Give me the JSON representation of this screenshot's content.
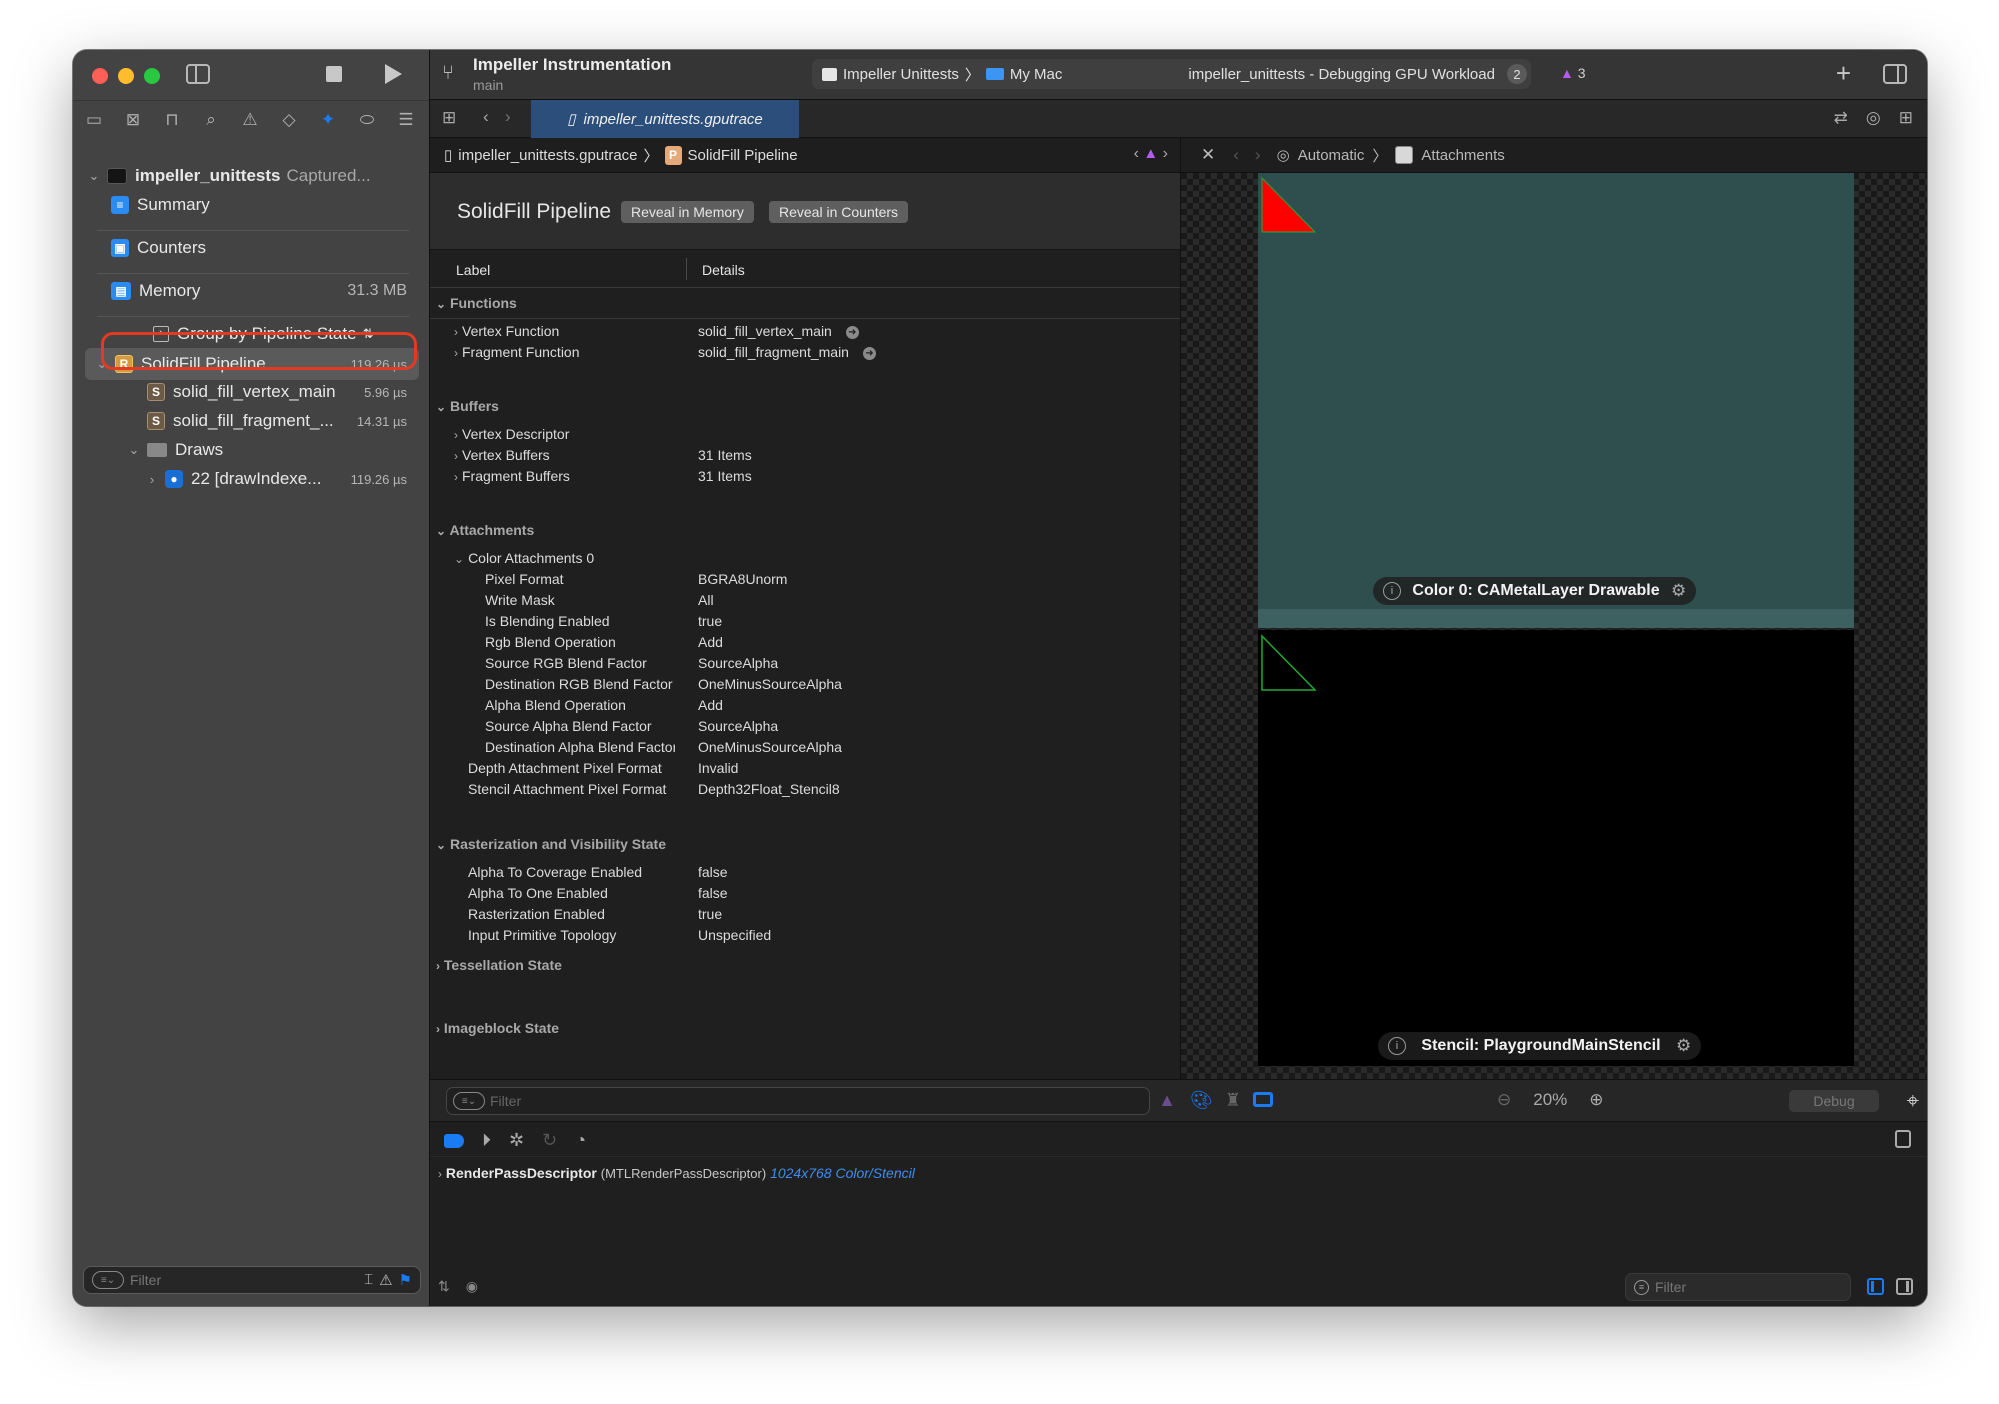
{
  "window": {
    "project_title": "Impeller Instrumentation",
    "branch": "main",
    "scheme": {
      "target": "Impeller Unittests",
      "destination": "My Mac"
    },
    "status": {
      "text": "impeller_unittests - Debugging GPU Workload",
      "badge": "2",
      "warnings": "3"
    }
  },
  "icons": {
    "sep": "〉",
    "chevron_right": "›",
    "chevron_down": "⌄",
    "back": "‹",
    "forward": "›",
    "plus": "+",
    "close": "✕",
    "warn": "▲",
    "gear": "⚙",
    "info": "i",
    "go": "➜",
    "updown": "⇅",
    "target": "⌖",
    "search_minus": "⊖",
    "search_plus": "⊕"
  },
  "navigator": {
    "tab_icons": [
      "folder-icon",
      "source-control-icon",
      "symbol-hierarchy-icon",
      "find-icon",
      "issue-icon",
      "test-icon",
      "debug-gpu-icon",
      "breakpoint-icon",
      "report-icon"
    ],
    "tab_glyphs": [
      "▭",
      "⊠",
      "⊓",
      "⌕",
      "⚠",
      "◇",
      "✦",
      "⬭",
      "☰"
    ],
    "root": {
      "name": "impeller_unittests",
      "status": "Captured..."
    },
    "summary": "Summary",
    "counters": "Counters",
    "memory": {
      "label": "Memory",
      "value": "31.3 MB"
    },
    "group_by": "Group by Pipeline State",
    "pipeline": {
      "badge": "R",
      "label": "SolidFill Pipeline",
      "value": "119.26 µs"
    },
    "functions": [
      {
        "badge": "S",
        "label": "solid_fill_vertex_main",
        "value": "5.96 µs"
      },
      {
        "badge": "S",
        "label": "solid_fill_fragment_...",
        "value": "14.31 µs"
      }
    ],
    "draws": "Draws",
    "draw_call": {
      "label": "22 [drawIndexe...",
      "value": "119.26 µs"
    },
    "filter_placeholder": "Filter"
  },
  "tabbar": {
    "active_tab": "impeller_unittests.gputrace"
  },
  "jumpbar": {
    "file": "impeller_unittests.gputrace",
    "badge": "P",
    "item": "SolidFill Pipeline"
  },
  "editor": {
    "title": "SolidFill Pipeline",
    "buttons": {
      "reveal_memory": "Reveal in Memory",
      "reveal_counters": "Reveal in Counters"
    },
    "columns": {
      "label": "Label",
      "details": "Details"
    },
    "sections": {
      "functions": "Functions",
      "buffers": "Buffers",
      "attachments": "Attachments",
      "color_attachments": "Color Attachments 0",
      "raster": "Rasterization and Visibility State",
      "tessellation": "Tessellation State",
      "imageblock": "Imageblock State"
    },
    "functions": [
      {
        "label": "Vertex Function",
        "value": "solid_fill_vertex_main"
      },
      {
        "label": "Fragment Function",
        "value": "solid_fill_fragment_main"
      }
    ],
    "buffers": [
      {
        "label": "Vertex Descriptor",
        "value": ""
      },
      {
        "label": "Vertex Buffers",
        "value": "31 Items"
      },
      {
        "label": "Fragment Buffers",
        "value": "31 Items"
      }
    ],
    "color_attachment": [
      {
        "label": "Pixel Format",
        "value": "BGRA8Unorm"
      },
      {
        "label": "Write Mask",
        "value": "All"
      },
      {
        "label": "Is Blending Enabled",
        "value": "true"
      },
      {
        "label": "Rgb Blend Operation",
        "value": "Add"
      },
      {
        "label": "Source RGB Blend Factor",
        "value": "SourceAlpha"
      },
      {
        "label": "Destination RGB Blend Factor",
        "value": "OneMinusSourceAlpha"
      },
      {
        "label": "Alpha Blend Operation",
        "value": "Add"
      },
      {
        "label": "Source Alpha Blend Factor",
        "value": "SourceAlpha"
      },
      {
        "label": "Destination Alpha Blend Factor",
        "value": "OneMinusSourceAlpha"
      }
    ],
    "attachment_formats": [
      {
        "label": "Depth Attachment Pixel Format",
        "value": "Invalid"
      },
      {
        "label": "Stencil Attachment Pixel Format",
        "value": "Depth32Float_Stencil8"
      }
    ],
    "raster": [
      {
        "label": "Alpha To Coverage Enabled",
        "value": "false"
      },
      {
        "label": "Alpha To One Enabled",
        "value": "false"
      },
      {
        "label": "Rasterization Enabled",
        "value": "true"
      },
      {
        "label": "Input Primitive Topology",
        "value": "Unspecified"
      }
    ],
    "filter_placeholder": "Filter"
  },
  "viewer": {
    "mode": "Automatic",
    "section": "Attachments",
    "color_label": "Color 0: CAMetalLayer Drawable",
    "stencil_label": "Stencil: PlaygroundMainStencil",
    "zoom": "20%",
    "debug_button": "Debug",
    "colors": {
      "clear": "#2f4f4f",
      "triangle_fill": "#ff0000",
      "triangle_outline": "#22aa33",
      "stencil_bg": "#000000"
    }
  },
  "debug": {
    "var_name": "RenderPassDescriptor",
    "var_type": "(MTLRenderPassDescriptor)",
    "var_summary": "1024x768 Color/Stencil",
    "filter_placeholder": "Filter"
  }
}
